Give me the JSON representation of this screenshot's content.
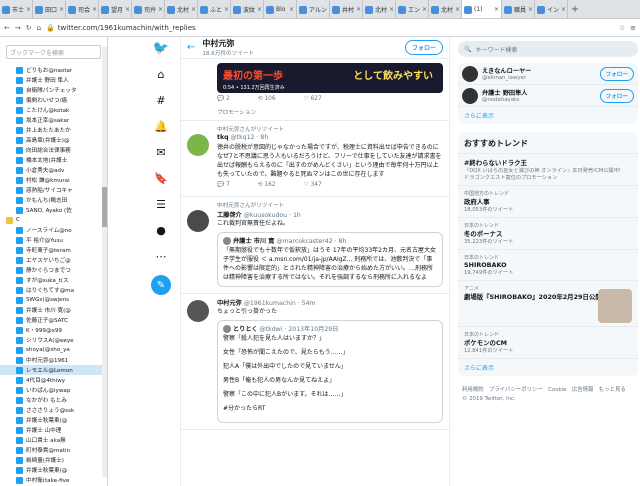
{
  "browser": {
    "tabs": [
      {
        "label": "市士"
      },
      {
        "label": "田口"
      },
      {
        "label": "司会"
      },
      {
        "label": "望月"
      },
      {
        "label": "司弁"
      },
      {
        "label": "北村"
      },
      {
        "label": "ふと"
      },
      {
        "label": "波紋"
      },
      {
        "label": "Blo"
      },
      {
        "label": "アルン"
      },
      {
        "label": "井村"
      },
      {
        "label": "北村"
      },
      {
        "label": "エン"
      },
      {
        "label": "北村"
      },
      {
        "label": "(1)"
      },
      {
        "label": "職員"
      },
      {
        "label": "イン"
      }
    ],
    "url": "twitter.com/1961kumachin/with_replies"
  },
  "bookmarks": {
    "search_placeholder": "ブックマークを検索",
    "items": [
      {
        "label": "どりもお@naotar"
      },
      {
        "label": "弁護士 野田 隼人"
      },
      {
        "label": "自衛隊パンチェッタ"
      },
      {
        "label": "傷剣わいせつ/痛"
      },
      {
        "label": "こたけん@kotak"
      },
      {
        "label": "坂本正幸@sakar"
      },
      {
        "label": "井上あたたあたか"
      },
      {
        "label": "高島章(弁護士)@"
      },
      {
        "label": "向田総合法律事務"
      },
      {
        "label": "橋本太地(弁護士"
      },
      {
        "label": "小倉秀夫@adv"
      },
      {
        "label": "村松 謙@kmurai"
      },
      {
        "label": "惑熱船/サイコキャ"
      },
      {
        "label": "かもんち(鴨志田"
      },
      {
        "label": "SANO, Ayako (佐"
      },
      {
        "label": "C",
        "folder": true
      },
      {
        "label": "ノースライム@no"
      },
      {
        "label": "平 裕介@Yusu"
      },
      {
        "label": "寺町東子@teram"
      },
      {
        "label": "エヤスヤいちご@"
      },
      {
        "label": "静かぐらつまでつ"
      },
      {
        "label": "すが@suka_t(ス"
      },
      {
        "label": "はりぐちてす@ma"
      },
      {
        "label": "SWGs(@swjens"
      },
      {
        "label": "弁護士 市川 寛(@"
      },
      {
        "label": "佐藤正子@SATC"
      },
      {
        "label": "K・999@x99"
      },
      {
        "label": "シリウスA(@eeye"
      },
      {
        "label": "shoya(@sho_ya"
      },
      {
        "label": "中村元弥@1961"
      },
      {
        "label": "レモエル@Lemon",
        "selected": true
      },
      {
        "label": "4代目@4thiwy"
      },
      {
        "label": "いわぱん@iywap"
      },
      {
        "label": "なかがわ もとみ"
      },
      {
        "label": "さささりょう@ssk"
      },
      {
        "label": "弁護士秋葉東(@"
      },
      {
        "label": "弁護士 山中理"
      },
      {
        "label": "山口貴士 aka無"
      },
      {
        "label": "町村泰貴@matin"
      },
      {
        "label": "嶋崎量(弁護士)"
      },
      {
        "label": "弁護士秋葉東(@"
      },
      {
        "label": "中村衛(take-five"
      }
    ]
  },
  "profile": {
    "name": "中村元弥",
    "tweet_count": "18.6万件のツイート",
    "follow_label": "フォロー"
  },
  "tweets": [
    {
      "type": "promo_banner",
      "banner_red": "最初の第一歩",
      "banner_yellow": "として飲みやすい",
      "banner_small": "0:54 • 131.2万回再生済み",
      "replies": "2",
      "retweets": "106",
      "likes": "627",
      "promo": "プロモーション"
    },
    {
      "context": "中村元弥さんがリツイート",
      "name": "tkq",
      "handle": "@tkq12 · 8h",
      "text": "徳井の脱税が意図的じゃなかった場合ですが、税理士に資料出せば申告できるのになぜ7と不思議に思う人もいるだろうけど、フリーで仕事をしていた友達が請求書を出せば報酬もらえるのに「出すのがめんどくさい」という理由で毎年何十万円以上も失っていたので、難題やると死ぬマンはこの世に存在します",
      "replies": "7",
      "retweets": "162",
      "likes": "347"
    },
    {
      "context": "中村元弥さんがリツイート",
      "name": "工藤啓介",
      "handle": "@kuusokudou · 1h",
      "text": "これ裁判官無責任だよね。",
      "quote_name": "弁護士 市川 寛",
      "quote_handle": "@marcokcaster42 · 8h",
      "quote_text": "「無期懲役でも十数年で仮釈放」はうそ 17年の平均33年2カ月、元名古屋大女子学生が服役 ＜ a.msn.com/01/ja-jp/AAIgZ... 刑務所では、池敷判決で「事件への影響は限定的」とされた精神障害の治療から始めた方がいい。…刑務所は精神障害を治療する所ではない。それを強調するなら刑務所に入れるなよ"
    },
    {
      "context": "",
      "name": "中村元弥",
      "handle": "@1961kumachin · 54m",
      "text": "ちょっと引っ掛かった",
      "quote_name": "とりとく",
      "quote_handle": "@tkdwi · 2013年10月29日",
      "quote_lines": [
        "警察「殺人犯を見た人はいますか？」",
        "女性「恐怖が聞こえたので、見たらもう……」",
        "犯人A「僕は外出中でしたので見ていません」",
        "男性B「俺も犯人の男なんか見てねえよ」",
        "警察「この中に犯人Bがいます。それは……」",
        "#分かったらRT"
      ]
    }
  ],
  "sidebar": {
    "search_placeholder": "キーワード検索",
    "accounts": [
      {
        "name": "えきなんローヤー",
        "handle": "@ekinan_lawyer",
        "follow": "フォロー"
      },
      {
        "name": "弁護士 野田隼人",
        "handle": "@nodahayato",
        "follow": "フォロー"
      }
    ],
    "more_label": "さらに表示",
    "trends_title": "おすすめトレンド",
    "trends": [
      {
        "category": "",
        "name": "#終わらないドラク王",
        "desc": "『DQX いばらの巫女と滅びの神 オンライン』本日発売!CM公開中!",
        "extra": "ドラゴンクエスト富位のプロモーション"
      },
      {
        "category": "中国地方のトレンド",
        "name": "政府人事",
        "desc": "18,053件のツイート"
      },
      {
        "category": "日本のトレンド",
        "name": "冬のボーナス",
        "desc": "35,223件のツイート"
      },
      {
        "category": "日本のトレンド",
        "name": "SHIROBAKO",
        "desc": "19,749件のツイート"
      },
      {
        "category": "アニメ",
        "name": "劇場版『SHIROBAKO』2020年2月29日公開へ",
        "desc": ""
      },
      {
        "category": "日本のトレンド",
        "name": "ポケモンのCM",
        "desc": "12,841件のツイート"
      }
    ],
    "trends_more": "さらに表示",
    "footer": "利用規約　プライバシーポリシー　Cookie　広告情報　もっと見る　© 2019 Twitter, Inc."
  }
}
